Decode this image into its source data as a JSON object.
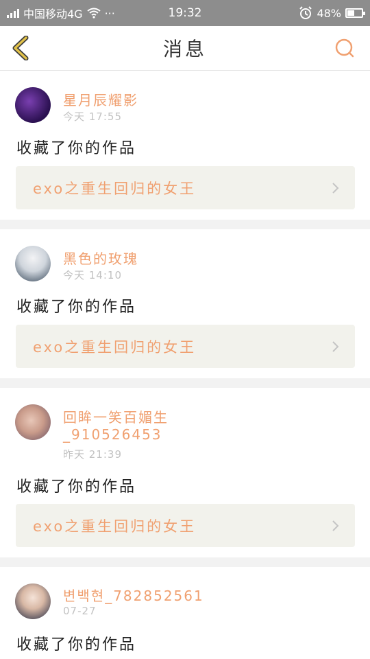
{
  "status": {
    "carrier": "中国移动4G",
    "dots": "···",
    "time": "19:32",
    "battery": "48%",
    "battery_level": 0.48
  },
  "nav": {
    "title": "消息"
  },
  "messages": [
    {
      "username": "星月辰耀影",
      "username_line2": "",
      "time": "今天 17:55",
      "action": "收藏了你的作品",
      "work_title": "exo之重生回归的女王"
    },
    {
      "username": "黑色的玫瑰",
      "username_line2": "",
      "time": "今天 14:10",
      "action": "收藏了你的作品",
      "work_title": "exo之重生回归的女王"
    },
    {
      "username": "回眸一笑百媚生",
      "username_line2": "_910526453",
      "time": "昨天 21:39",
      "action": "收藏了你的作品",
      "work_title": "exo之重生回归的女王"
    },
    {
      "username": "변백현_782852561",
      "username_line2": "",
      "time": "07-27",
      "action": "收藏了你的作品",
      "work_title": ""
    }
  ],
  "colors": {
    "accent": "#f0a070",
    "back_arrow": "#e2c24a",
    "status_bar": "#8d8d8d"
  }
}
